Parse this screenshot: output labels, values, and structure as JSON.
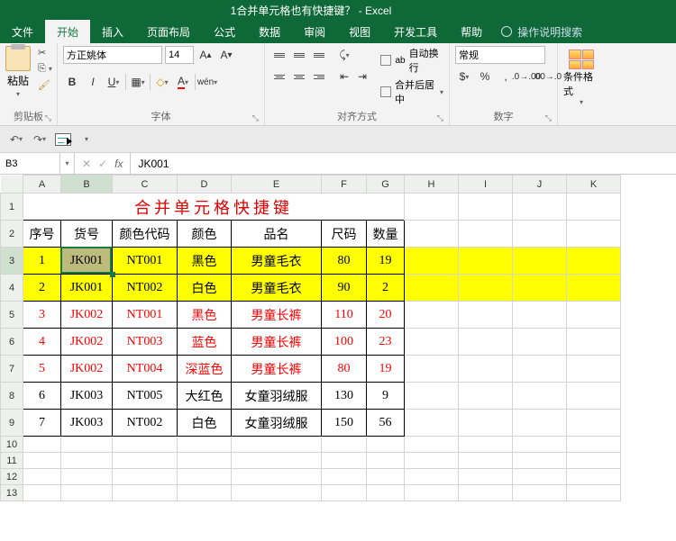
{
  "title": "1合并单元格也有快捷键？ - Excel",
  "menu": [
    "文件",
    "开始",
    "插入",
    "页面布局",
    "公式",
    "数据",
    "审阅",
    "视图",
    "开发工具",
    "帮助"
  ],
  "menu_active": 1,
  "tell_me": "操作说明搜索",
  "ribbon": {
    "clipboard": {
      "paste": "粘贴",
      "label": "剪贴板"
    },
    "font": {
      "name": "方正姚体",
      "size": "14",
      "label": "字体"
    },
    "alignment": {
      "wrap": "自动换行",
      "merge": "合并后居中",
      "label": "对齐方式"
    },
    "number": {
      "format": "常规",
      "label": "数字"
    },
    "styles": {
      "cond": "条件格式"
    }
  },
  "name_box": "B3",
  "formula": "JK001",
  "columns": [
    "A",
    "B",
    "C",
    "D",
    "E",
    "F",
    "G",
    "H",
    "I",
    "J",
    "K"
  ],
  "sheet_title": "合并单元格快捷键",
  "headers": [
    "序号",
    "货号",
    "颜色代码",
    "颜色",
    "品名",
    "尺码",
    "数量"
  ],
  "rows": [
    {
      "n": "1",
      "code": "JK001",
      "cc": "NT001",
      "color": "黑色",
      "name": "男童毛衣",
      "size": "80",
      "qty": "19",
      "cls": "ylw",
      "sel": true
    },
    {
      "n": "2",
      "code": "JK001",
      "cc": "NT002",
      "color": "白色",
      "name": "男童毛衣",
      "size": "90",
      "qty": "2",
      "cls": "ylw"
    },
    {
      "n": "3",
      "code": "JK002",
      "cc": "NT001",
      "color": "黑色",
      "name": "男童长裤",
      "size": "110",
      "qty": "20",
      "cls": "redtxt"
    },
    {
      "n": "4",
      "code": "JK002",
      "cc": "NT003",
      "color": "蓝色",
      "name": "男童长裤",
      "size": "100",
      "qty": "23",
      "cls": "redtxt"
    },
    {
      "n": "5",
      "code": "JK002",
      "cc": "NT004",
      "color": "深蓝色",
      "name": "男童长裤",
      "size": "80",
      "qty": "19",
      "cls": "redtxt"
    },
    {
      "n": "6",
      "code": "JK003",
      "cc": "NT005",
      "color": "大红色",
      "name": "女童羽绒服",
      "size": "130",
      "qty": "9",
      "cls": ""
    },
    {
      "n": "7",
      "code": "JK003",
      "cc": "NT002",
      "color": "白色",
      "name": "女童羽绒服",
      "size": "150",
      "qty": "56",
      "cls": ""
    }
  ],
  "chart_data": {
    "type": "table",
    "title": "合并单元格快捷键",
    "columns": [
      "序号",
      "货号",
      "颜色代码",
      "颜色",
      "品名",
      "尺码",
      "数量"
    ],
    "data": [
      [
        1,
        "JK001",
        "NT001",
        "黑色",
        "男童毛衣",
        80,
        19
      ],
      [
        2,
        "JK001",
        "NT002",
        "白色",
        "男童毛衣",
        90,
        2
      ],
      [
        3,
        "JK002",
        "NT001",
        "黑色",
        "男童长裤",
        110,
        20
      ],
      [
        4,
        "JK002",
        "NT003",
        "蓝色",
        "男童长裤",
        100,
        23
      ],
      [
        5,
        "JK002",
        "NT004",
        "深蓝色",
        "男童长裤",
        80,
        19
      ],
      [
        6,
        "JK003",
        "NT005",
        "大红色",
        "女童羽绒服",
        130,
        9
      ],
      [
        7,
        "JK003",
        "NT002",
        "白色",
        "女童羽绒服",
        150,
        56
      ]
    ]
  }
}
